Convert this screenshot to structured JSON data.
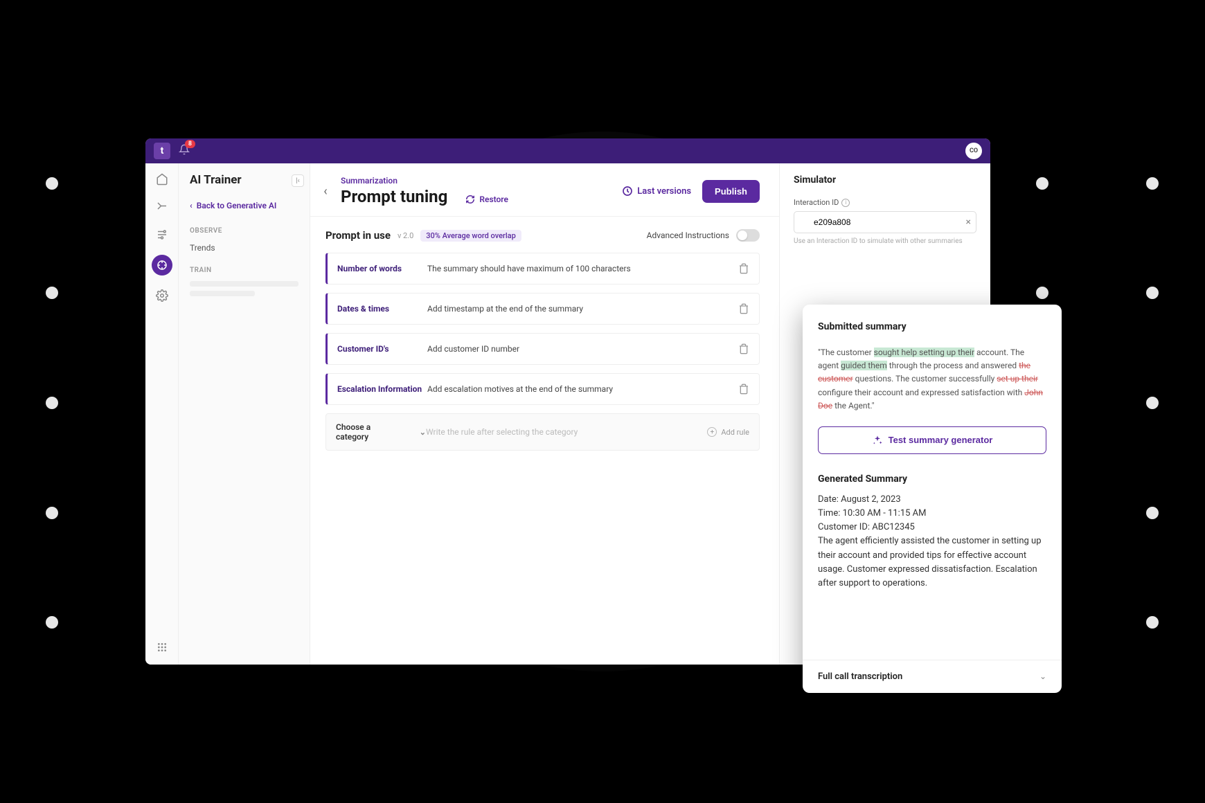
{
  "titlebar": {
    "logo_text": "t",
    "badge": "8",
    "avatar": "CO"
  },
  "sidebar": {
    "title": "AI Trainer",
    "back": "Back to Generative AI",
    "groups": [
      {
        "label": "OBSERVE",
        "items": [
          "Trends"
        ]
      },
      {
        "label": "TRAIN",
        "items": []
      }
    ]
  },
  "header": {
    "breadcrumb": "Summarization",
    "title": "Prompt tuning",
    "restore": "Restore",
    "last_versions": "Last versions",
    "publish": "Publish"
  },
  "prompt": {
    "title": "Prompt in use",
    "version": "v 2.0",
    "overlap": "30% Average word overlap",
    "advanced_label": "Advanced Instructions",
    "rules": [
      {
        "name": "Number of words",
        "desc": "The summary should have maximum of 100 characters"
      },
      {
        "name": "Dates & times",
        "desc": "Add timestamp at the end of the summary"
      },
      {
        "name": "Customer ID's",
        "desc": "Add customer ID number"
      },
      {
        "name": "Escalation Information",
        "desc": "Add escalation motives at the end of the summary"
      }
    ],
    "category_label": "Choose a category",
    "rule_placeholder": "Write the rule after selecting the category",
    "add_rule": "Add rule"
  },
  "simulator": {
    "title": "Simulator",
    "field_label": "Interaction ID",
    "value": "e209a808",
    "helper": "Use an Interaction ID to simulate with other summaries"
  },
  "card": {
    "submitted_title": "Submitted summary",
    "summary_parts": {
      "p1": "\"The customer ",
      "h1": "sought help setting up their",
      "p2": " account. The agent ",
      "h2": "guided them",
      "p3": " through the process and answered ",
      "s1": "the customer",
      "p4": " questions. The customer successfully ",
      "s2": "set up their",
      "p5": " configure their account and expressed satisfaction with ",
      "s3": "John Doe",
      "p6": " the Agent.\""
    },
    "test_btn": "Test summary generator",
    "generated_title": "Generated Summary",
    "generated_lines": {
      "date": "Date: August 2, 2023",
      "time": "Time: 10:30 AM - 11:15 AM",
      "cid": "Customer ID: ABC12345",
      "body": "The agent efficiently assisted the customer in setting up their account and provided tips for effective account usage. Customer expressed dissatisfaction. Escalation after support to operations."
    },
    "transcript": "Full call transcription"
  }
}
